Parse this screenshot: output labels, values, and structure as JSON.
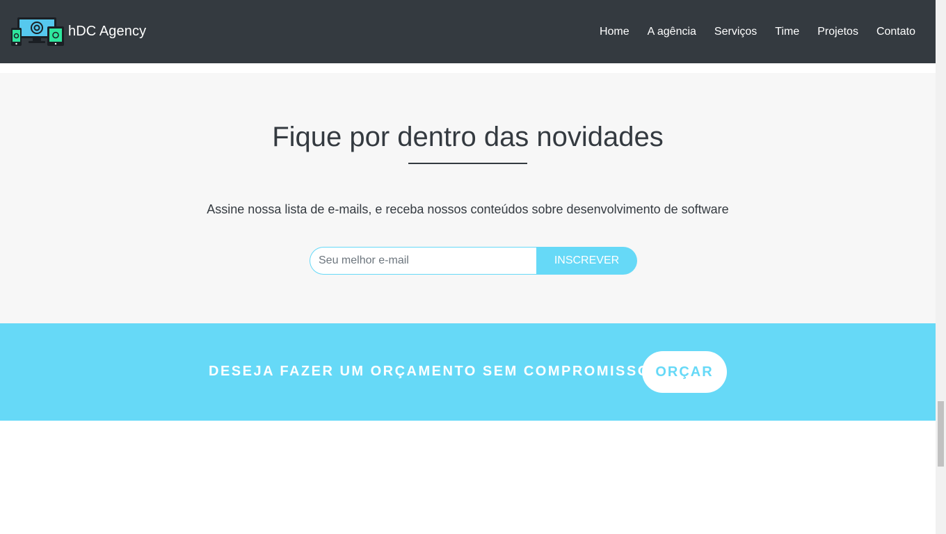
{
  "navbar": {
    "brand_name": "hDC Agency",
    "links": [
      "Home",
      "A agência",
      "Serviços",
      "Time",
      "Projetos",
      "Contato"
    ]
  },
  "newsletter": {
    "title": "Fique por dentro das novidades",
    "description": "Assine nossa lista de e-mails, e receba nossos conteúdos sobre desenvolvimento de software",
    "email_placeholder": "Seu melhor e-mail",
    "email_value": "",
    "subscribe_label": "INSCREVER"
  },
  "cta": {
    "text": "DESEJA FAZER UM ORÇAMENTO SEM COMPROMISSO?",
    "button_label": "ORÇAR"
  },
  "colors": {
    "navbar_bg": "#343a40",
    "accent": "#66d9f7",
    "section_bg": "#f7f7f7",
    "text_dark": "#343a40"
  },
  "icons": {
    "brand_logo": "devices-logo-icon"
  }
}
